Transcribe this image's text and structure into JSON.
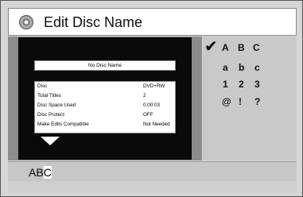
{
  "window": {
    "title": "Edit Disc Name",
    "icon": "disc-icon"
  },
  "preview": {
    "disc_name": "No Disc Name",
    "info": [
      {
        "label": "Disc",
        "value": "DVD+RW"
      },
      {
        "label": "Total Titles",
        "value": "2"
      },
      {
        "label": "Disc Space Used",
        "value": "0:00:03"
      },
      {
        "label": "Disc Protect",
        "value": "OFF"
      },
      {
        "label": "Make Edits Compatible",
        "value": "Not Needed"
      }
    ]
  },
  "keyboard": {
    "selected_icon": "checkmark-icon",
    "rows": [
      [
        "A",
        "B",
        "C"
      ],
      [
        "a",
        "b",
        "c"
      ],
      [
        "1",
        "2",
        "3"
      ],
      [
        "@",
        "!",
        "?"
      ]
    ]
  },
  "input": {
    "text_before_cursor": "AB",
    "cursor_char": "C"
  }
}
